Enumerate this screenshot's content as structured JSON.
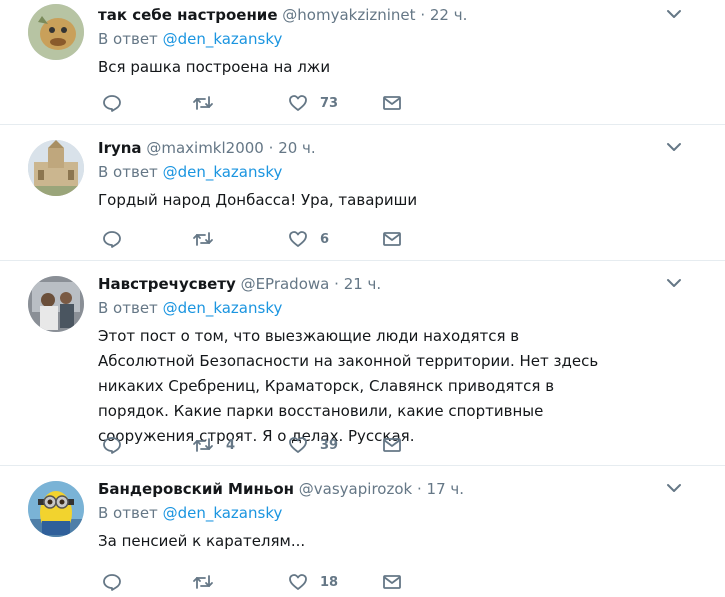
{
  "tweets": [
    {
      "name": "так себе настроение",
      "handle": "@homyakzizninet",
      "sep": "·",
      "time": "22 ч.",
      "reply_prefix": "В ответ",
      "reply_to": "@den_kazansky",
      "text": "Вся рашка построена на лжи",
      "retweets": "",
      "likes": "73"
    },
    {
      "name": "Iryna",
      "handle": "@maximkl2000",
      "sep": "·",
      "time": "20 ч.",
      "reply_prefix": "В ответ",
      "reply_to": "@den_kazansky",
      "text": "Гордый народ Донбасса! Ура, тавариши",
      "retweets": "",
      "likes": "6"
    },
    {
      "name": "Навстречусвету",
      "handle": "@EPradowa",
      "sep": "·",
      "time": "21 ч.",
      "reply_prefix": "В ответ",
      "reply_to": "@den_kazansky",
      "text": "Этот пост о том, что выезжающие люди находятся в Абсолютной Безопасности на законной территории. Нет здесь никаких Сребрениц, Краматорск, Славянск приводятся в порядок. Какие парки восстановили, какие спортивные сооружения строят. Я о делах. Русская.",
      "retweets": "4",
      "likes": "39"
    },
    {
      "name": "Бандеровский Миньон",
      "handle": "@vasyapirozok",
      "sep": "·",
      "time": "17 ч.",
      "reply_prefix": "В ответ",
      "reply_to": "@den_kazansky",
      "text": "За пенсией к карателям...",
      "retweets": "",
      "likes": "18"
    }
  ],
  "colors": {
    "text": "#14171a",
    "secondary": "#657786",
    "link": "#1b95e0",
    "divider": "#e6ecf0"
  },
  "icons": [
    "reply-icon",
    "retweet-icon",
    "like-icon",
    "direct-message-icon",
    "chevron-down-icon"
  ]
}
